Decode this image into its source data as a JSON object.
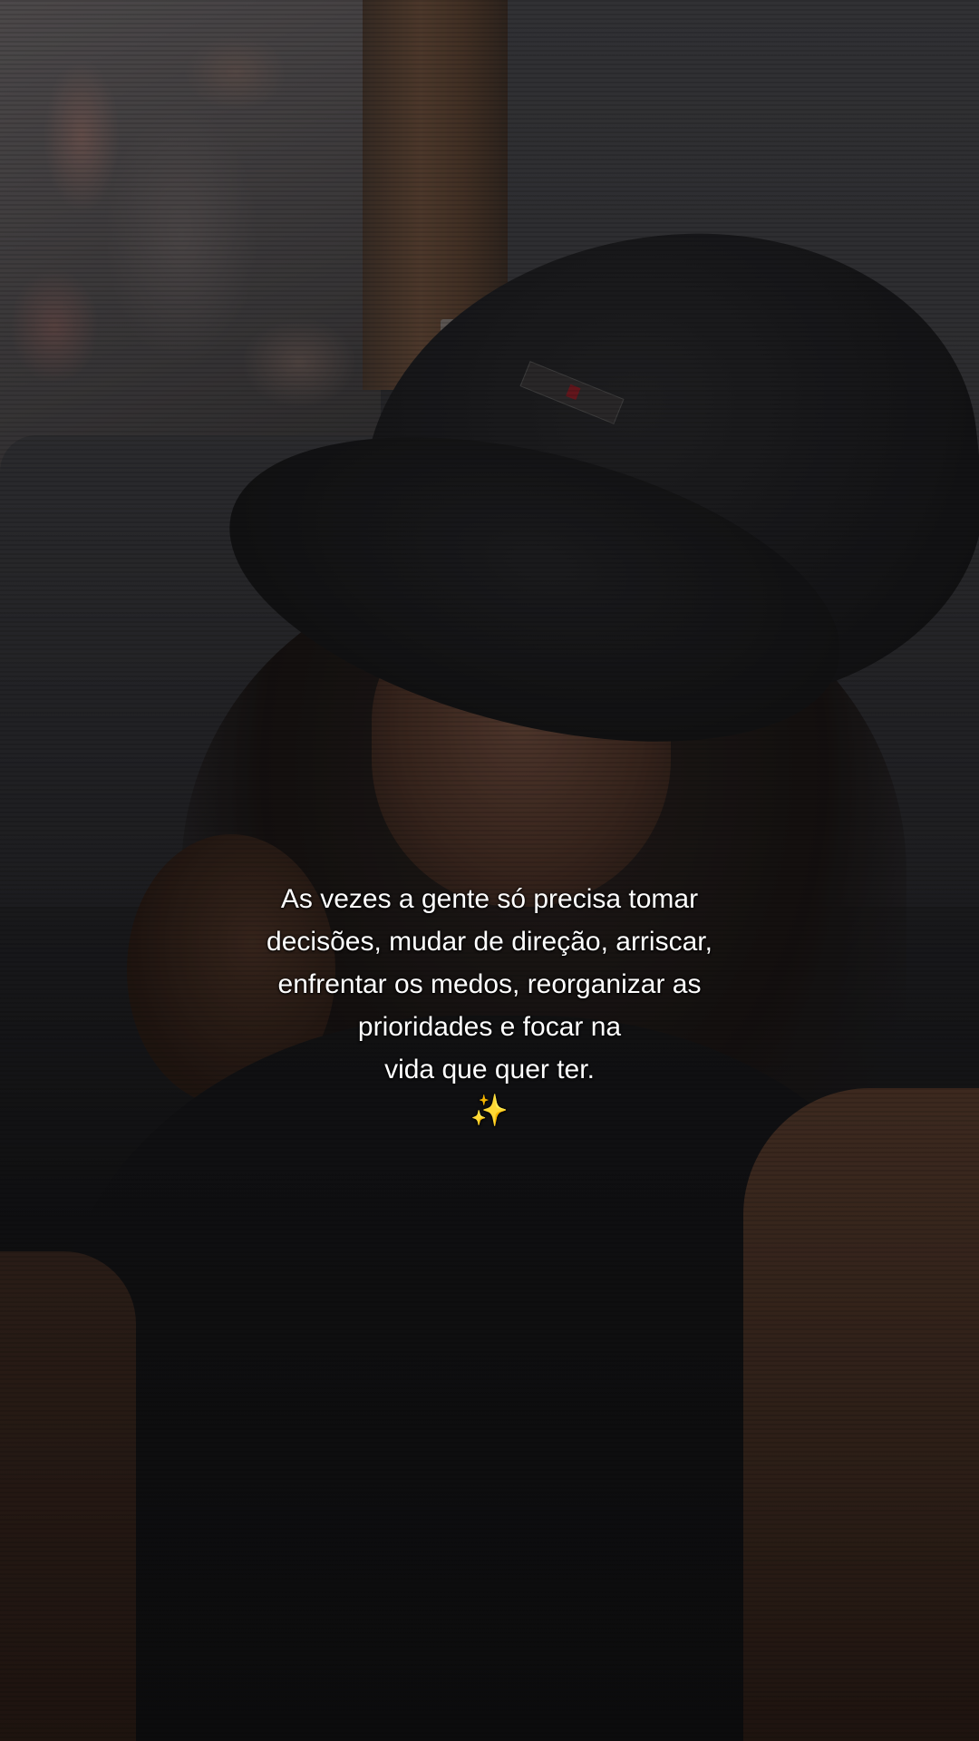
{
  "caption": {
    "lines": [
      "As vezes a gente só precisa tomar",
      "decisões, mudar de direção, arriscar,",
      "enfrentar os medos, reorganizar as",
      "prioridades e focar na",
      "vida que quer ter."
    ],
    "emoji": "✨"
  },
  "colors": {
    "caption_text": "#ffffff",
    "sparkles": "#ffd86a"
  }
}
